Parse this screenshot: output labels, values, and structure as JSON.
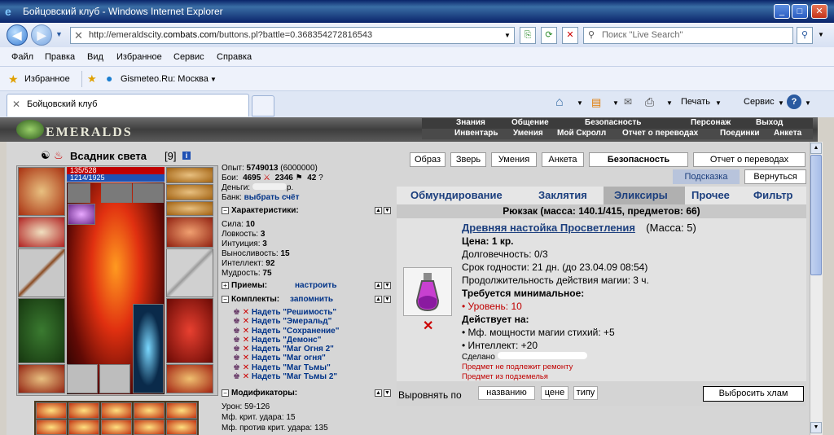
{
  "window": {
    "title": "Бойцовский клуб - Windows Internet Explorer"
  },
  "address": {
    "prefix": "http://emeraldscity.",
    "domain": "combats.com",
    "suffix": "/buttons.pl?battle=0.368354272816543"
  },
  "search": {
    "placeholder": "Поиск \"Live Search\""
  },
  "menu": [
    "Файл",
    "Правка",
    "Вид",
    "Избранное",
    "Сервис",
    "Справка"
  ],
  "favbar": {
    "favorites": "Избранное",
    "gismeteo": "Gismeteo.Ru: Москва"
  },
  "tab": {
    "label": "Бойцовский клуб"
  },
  "ie_cmd": {
    "print": "Печать",
    "service": "Сервис"
  },
  "game": {
    "logo": "EMERALDS",
    "nav1": [
      "Знания",
      "Общение",
      "Безопасность",
      "Персонаж",
      "Выход"
    ],
    "nav2": [
      "Инвентарь",
      "Умения",
      "Мой Скролл",
      "Отчет о переводах",
      "Поединки",
      "Анкета"
    ]
  },
  "character": {
    "name": "Всадник света",
    "level": "[9]",
    "hp": "135/528",
    "mana": "1214/1925",
    "exp_label": "Опыт:",
    "exp": "5749013",
    "exp_next": "(6000000)",
    "battles_label": "Бои:",
    "wins": "4695",
    "losses": "2346",
    "draws": "42",
    "money_label": "Деньги:",
    "money_suffix": "р.",
    "bank_label": "Банк:",
    "bank_link": "выбрать счёт",
    "stats_title": "Характеристики:",
    "stats": [
      {
        "label": "Сила:",
        "value": "10"
      },
      {
        "label": "Ловкость:",
        "value": "3"
      },
      {
        "label": "Интуиция:",
        "value": "3"
      },
      {
        "label": "Выносливость:",
        "value": "15"
      },
      {
        "label": "Интеллект:",
        "value": "92"
      },
      {
        "label": "Мудрость:",
        "value": "75"
      }
    ],
    "tricks_title": "Приемы:",
    "tricks_link": "настроить",
    "sets_title": "Комплекты:",
    "sets_link": "запомнить",
    "sets": [
      "Надеть \"Решимость\"",
      "Надеть \"Эмеральд\"",
      "Надеть \"Сохранение\"",
      "Надеть \"Демонс\"",
      "Надеть \"Маг Огня 2\"",
      "Надеть \"Маг огня\"",
      "Надеть \"Маг Тьмы\"",
      "Надеть \"Маг Тьмы 2\""
    ],
    "mods_title": "Модификаторы:",
    "mods": [
      "Урон: 59-126",
      "Мф. крит. удара: 15",
      "Мф. против крит. удара: 135"
    ]
  },
  "right": {
    "buttons": [
      "Образ",
      "Зверь",
      "Умения",
      "Анкета",
      "Безопасность",
      "Отчет о переводах"
    ],
    "hint": "Подсказка",
    "back": "Вернуться",
    "categories": [
      "Обмундирование",
      "Заклятия",
      "Эликсиры",
      "Прочее",
      "Фильтр"
    ],
    "active_category": "Эликсиры",
    "rukzak": "Рюкзак (масса: 140.1/415, предметов: 66)",
    "item": {
      "name": "Древняя настойка Просветления",
      "mass": "(Масса: 5)",
      "price": "Цена: 1 кр.",
      "durability": "Долговечность: 0/3",
      "expiry": "Срок годности: 21 дн. (до 23.04.09 08:54)",
      "duration": "Продолжительность действия магии: 3 ч.",
      "req_title": "Требуется минимальное:",
      "req_level": "Уровень: 10",
      "effect_title": "Действует на:",
      "effects": [
        "Мф. мощности магии стихий: +5",
        "Интеллект: +20"
      ],
      "made": "Сделано",
      "no_repair": "Предмет не подлежит ремонту",
      "dungeon": "Предмет из подземелья"
    },
    "sort_label": "Выровнять по",
    "sort": [
      "названию",
      "цене",
      "типу"
    ],
    "discard": "Выбросить хлам"
  },
  "colors": {
    "accent": "#1c3f7e",
    "red": "#c00000",
    "hp": "#c00000",
    "mana": "#1e50b4"
  }
}
